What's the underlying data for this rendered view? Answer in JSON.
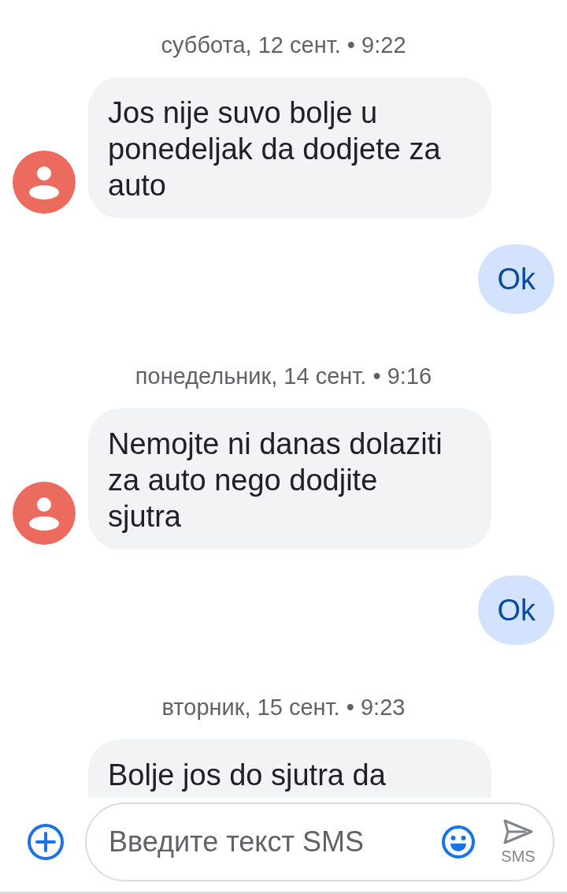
{
  "messages": [
    {
      "kind": "date",
      "text": "суббота, 12 сент. • 9:22"
    },
    {
      "kind": "incoming",
      "text": "Jos nije suvo bolje u ponedeljak da dodjete za auto",
      "cut_off": false
    },
    {
      "kind": "outgoing",
      "text": "Ok"
    },
    {
      "kind": "date",
      "text": "понедельник, 14 сент. • 9:16"
    },
    {
      "kind": "incoming",
      "text": "Nemojte ni danas dolaziti za auto nego dodjite sjutra",
      "cut_off": false
    },
    {
      "kind": "outgoing",
      "text": "Ok"
    },
    {
      "kind": "date",
      "text": "вторник, 15 сент. • 9:23"
    },
    {
      "kind": "incoming",
      "text": "Bolje jos do sjutra da",
      "cut_off": true
    }
  ],
  "composer": {
    "placeholder": "Введите текст SMS",
    "send_label": "SMS"
  }
}
